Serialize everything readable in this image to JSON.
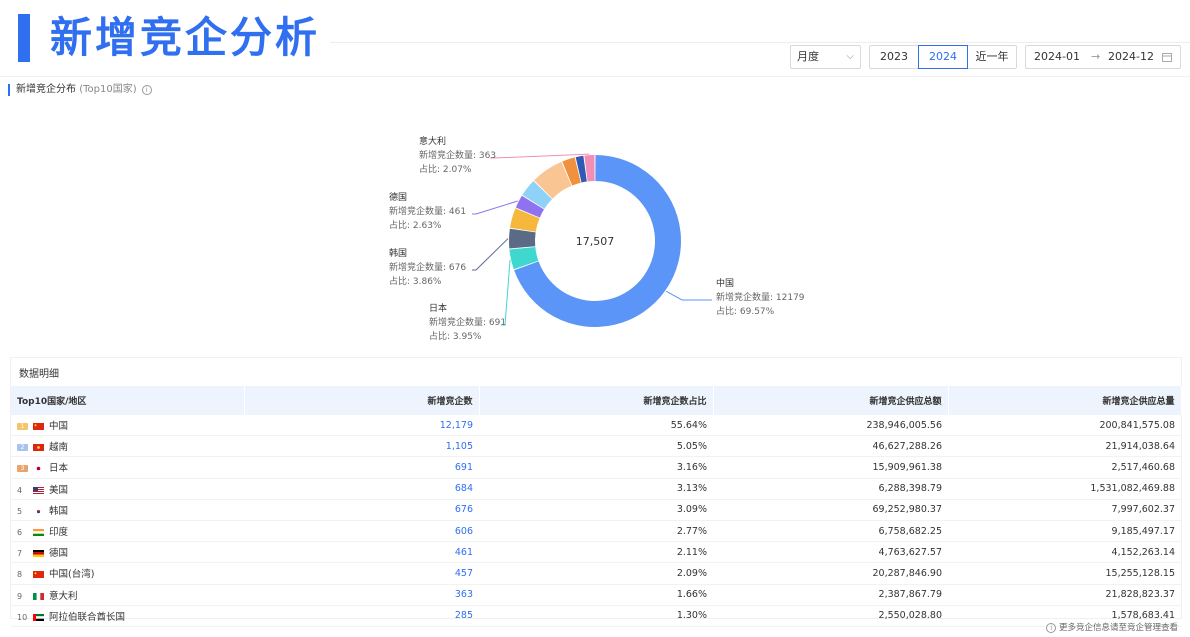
{
  "page_title": "新增竞企分析",
  "controls": {
    "granularity": "月度",
    "years": [
      "2023",
      "2024"
    ],
    "active_year": "2024",
    "recent": "近一年",
    "date_start": "2024-01",
    "date_end": "2024-12",
    "arrow": "→"
  },
  "section": {
    "title": "新增竞企分布",
    "subtitle": "(Top10国家)"
  },
  "chart_data": {
    "type": "pie",
    "total_label": "17,507",
    "slices": [
      {
        "name": "中国",
        "value": 12179,
        "pct": "69.57%",
        "color": "#5b95f7"
      },
      {
        "name": "日本",
        "value": 691,
        "pct": "3.95%",
        "color": "#3fd8cf"
      },
      {
        "name": "韩国",
        "value": 676,
        "pct": "3.86%",
        "color": "#5b6b86"
      },
      {
        "name": "美国",
        "value": 684,
        "pct": "",
        "color": "#f5b83d"
      },
      {
        "name": "德国",
        "value": 461,
        "pct": "2.63%",
        "color": "#8f72f0"
      },
      {
        "name": "印度",
        "value": 606,
        "pct": "",
        "color": "#8fd2f7"
      },
      {
        "name": "越南",
        "value": 1105,
        "pct": "",
        "color": "#f9c693"
      },
      {
        "name": "中国(台湾)",
        "value": 457,
        "pct": "",
        "color": "#f0913f"
      },
      {
        "name": "阿拉伯联合酋长国",
        "value": 285,
        "pct": "",
        "color": "#2e59b5"
      },
      {
        "name": "意大利",
        "value": 363,
        "pct": "2.07%",
        "color": "#f28db8"
      }
    ],
    "label_prefix_count": "新增竞企数量: ",
    "label_prefix_pct": "占比: "
  },
  "table": {
    "title": "数据明细",
    "headers": [
      "Top10国家/地区",
      "新增竞企数",
      "新增竞企数占比",
      "新增竞企供应总额",
      "新增竞企供应总量"
    ],
    "rows": [
      {
        "rank": "1",
        "country": "中国",
        "count": "12,179",
        "share": "55.64%",
        "amount": "238,946,005.56",
        "volume": "200,841,575.08"
      },
      {
        "rank": "2",
        "country": "越南",
        "count": "1,105",
        "share": "5.05%",
        "amount": "46,627,288.26",
        "volume": "21,914,038.64"
      },
      {
        "rank": "3",
        "country": "日本",
        "count": "691",
        "share": "3.16%",
        "amount": "15,909,961.38",
        "volume": "2,517,460.68"
      },
      {
        "rank": "4",
        "country": "美国",
        "count": "684",
        "share": "3.13%",
        "amount": "6,288,398.79",
        "volume": "1,531,082,469.88"
      },
      {
        "rank": "5",
        "country": "韩国",
        "count": "676",
        "share": "3.09%",
        "amount": "69,252,980.37",
        "volume": "7,997,602.37"
      },
      {
        "rank": "6",
        "country": "印度",
        "count": "606",
        "share": "2.77%",
        "amount": "6,758,682.25",
        "volume": "9,185,497.17"
      },
      {
        "rank": "7",
        "country": "德国",
        "count": "461",
        "share": "2.11%",
        "amount": "4,763,627.57",
        "volume": "4,152,263.14"
      },
      {
        "rank": "8",
        "country": "中国(台湾)",
        "count": "457",
        "share": "2.09%",
        "amount": "20,287,846.90",
        "volume": "15,255,128.15"
      },
      {
        "rank": "9",
        "country": "意大利",
        "count": "363",
        "share": "1.66%",
        "amount": "2,387,867.79",
        "volume": "21,828,823.37"
      },
      {
        "rank": "10",
        "country": "阿拉伯联合酋长国",
        "count": "285",
        "share": "1.30%",
        "amount": "2,550,028.80",
        "volume": "1,578,683.41"
      }
    ]
  },
  "footnote": "更多竞企信息请至竞企管理查看"
}
